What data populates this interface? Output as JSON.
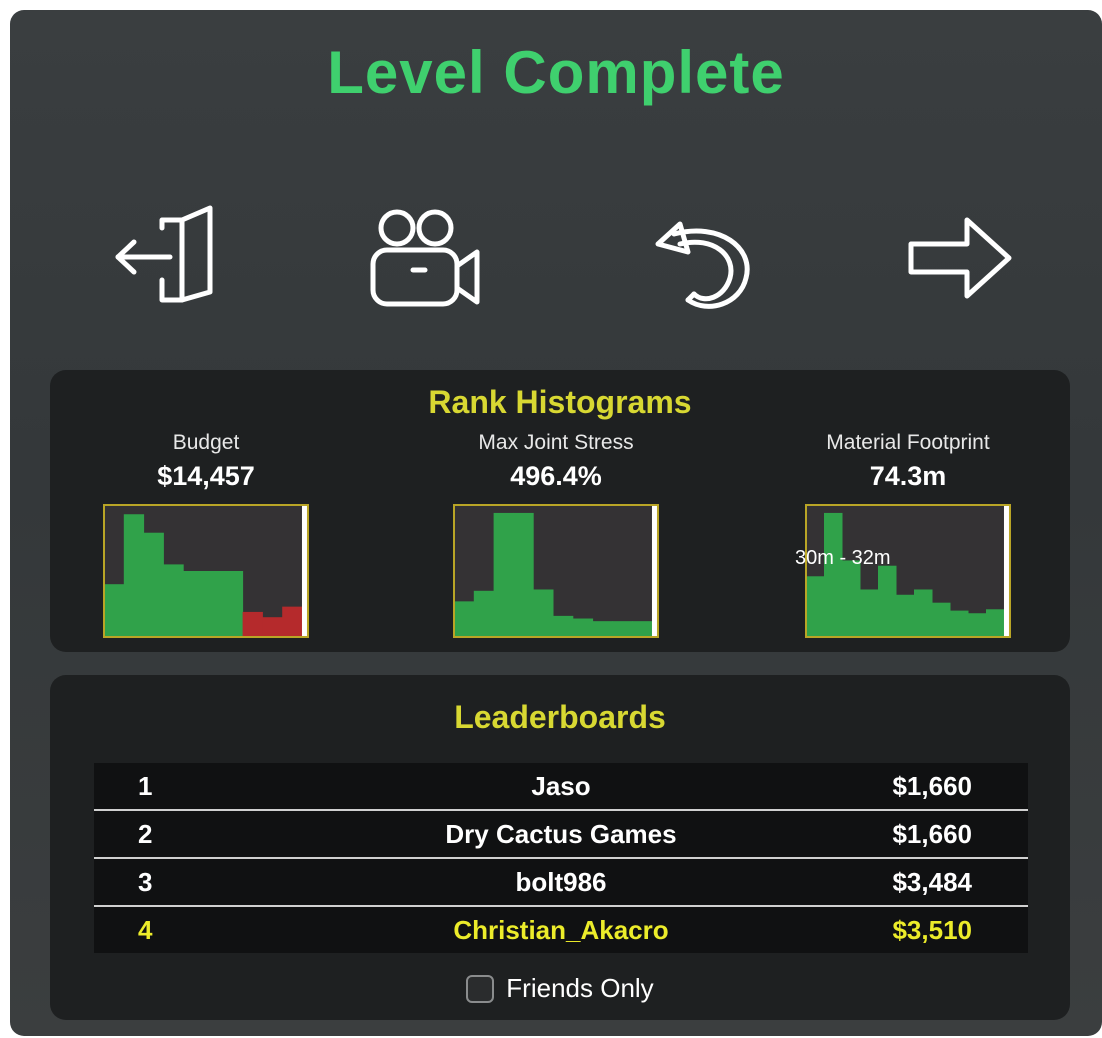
{
  "title": "Level Complete",
  "actions": [
    {
      "icon": "exit-door-icon"
    },
    {
      "icon": "replay-camera-icon"
    },
    {
      "icon": "restart-icon"
    },
    {
      "icon": "next-arrow-icon"
    }
  ],
  "rank_histograms": {
    "title": "Rank Histograms",
    "items": [
      {
        "label": "Budget",
        "value": "$14,457",
        "bins": [
          0.4,
          0.93,
          0.79,
          0.55,
          0.5,
          0.5,
          0.5,
          0.19,
          0.15,
          0.23
        ],
        "bin_colors": [
          "#30a24a",
          "#30a24a",
          "#30a24a",
          "#30a24a",
          "#30a24a",
          "#30a24a",
          "#30a24a",
          "#b52a2c",
          "#b52a2c",
          "#b52a2c"
        ],
        "marker": 0.995,
        "tooltip": ""
      },
      {
        "label": "Max Joint Stress",
        "value": "496.4%",
        "bins": [
          0.27,
          0.35,
          0.94,
          0.94,
          0.36,
          0.16,
          0.14,
          0.12,
          0.12,
          0.12
        ],
        "bin_colors": [
          "#30a24a",
          "#30a24a",
          "#30a24a",
          "#30a24a",
          "#30a24a",
          "#30a24a",
          "#30a24a",
          "#30a24a",
          "#30a24a",
          "#30a24a"
        ],
        "marker": 0.995,
        "tooltip": ""
      },
      {
        "label": "Material Footprint",
        "value": "74.3m",
        "bins": [
          0.46,
          0.94,
          0.58,
          0.36,
          0.54,
          0.32,
          0.36,
          0.26,
          0.2,
          0.18,
          0.21
        ],
        "bin_colors": [
          "#30a24a",
          "#30a24a",
          "#30a24a",
          "#30a24a",
          "#30a24a",
          "#30a24a",
          "#30a24a",
          "#30a24a",
          "#30a24a",
          "#30a24a",
          "#30a24a"
        ],
        "marker": 0.995,
        "tooltip": "30m - 32m"
      }
    ]
  },
  "leaderboards": {
    "title": "Leaderboards",
    "rows": [
      {
        "rank": "1",
        "name": "Jaso",
        "score": "$1,660",
        "is_player": false
      },
      {
        "rank": "2",
        "name": "Dry Cactus Games",
        "score": "$1,660",
        "is_player": false
      },
      {
        "rank": "3",
        "name": "bolt986",
        "score": "$3,484",
        "is_player": false
      },
      {
        "rank": "4",
        "name": "Christian_Akacro",
        "score": "$3,510",
        "is_player": true
      }
    ],
    "friends_only_label": "Friends Only",
    "friends_only_checked": false
  },
  "colors": {
    "title": "#3fd06e",
    "section_title": "#d8d832",
    "player_highlight": "#ecec2a",
    "histogram_frame": "#b9a526",
    "histogram_bg": "#343234",
    "bar_good": "#30a24a",
    "bar_bad": "#b52a2c"
  }
}
